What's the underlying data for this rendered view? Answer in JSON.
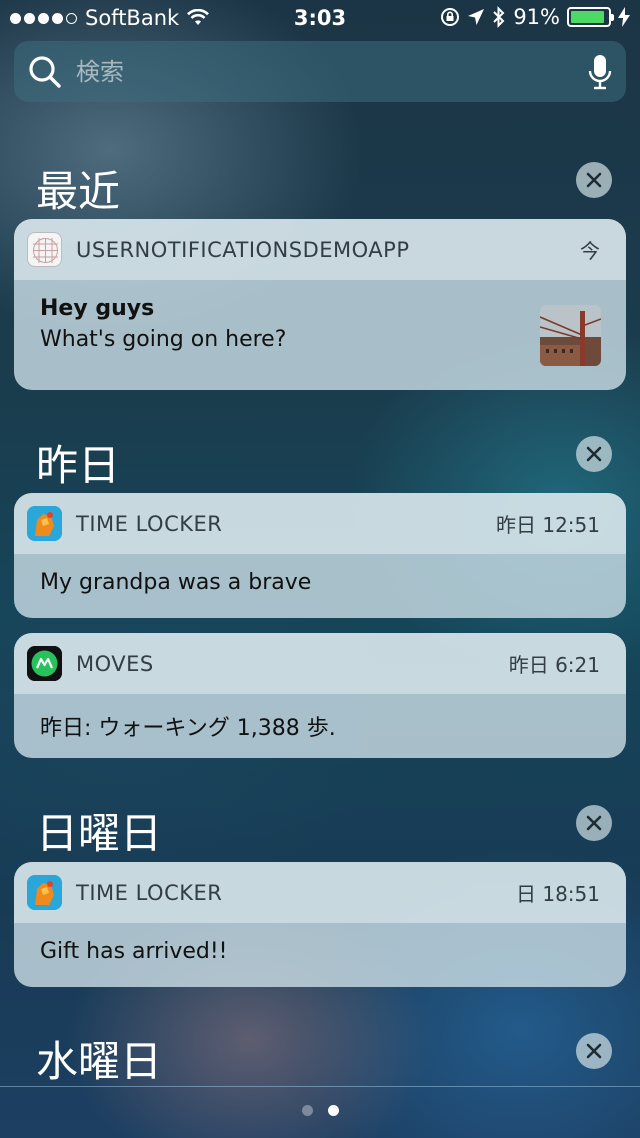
{
  "status_bar": {
    "carrier": "SoftBank",
    "time": "3:03",
    "battery_percent": "91%",
    "battery_level": 0.91,
    "signal_dots_filled": 4,
    "signal_dots_total": 5
  },
  "search": {
    "placeholder": "検索"
  },
  "sections": [
    {
      "title": "最近",
      "notifications": [
        {
          "app": "USERNOTIFICATIONSDEMOAPP",
          "time": "今",
          "title": "Hey guys",
          "body": "What's going on here?",
          "icon": "grid-app-icon",
          "has_thumbnail": true
        }
      ]
    },
    {
      "title": "昨日",
      "notifications": [
        {
          "app": "TIME LOCKER",
          "time": "昨日 12:51",
          "body": "My grandpa was a brave",
          "icon": "time-locker-icon"
        },
        {
          "app": "MOVES",
          "time": "昨日 6:21",
          "body": "昨日: ウォーキング 1,388 歩.",
          "icon": "moves-icon"
        }
      ]
    },
    {
      "title": "日曜日",
      "notifications": [
        {
          "app": "TIME LOCKER",
          "time": "日 18:51",
          "body": "Gift has arrived!!",
          "icon": "time-locker-icon"
        }
      ]
    },
    {
      "title": "水曜日",
      "notifications": []
    }
  ],
  "pager": {
    "pages": 2,
    "active": 2
  },
  "colors": {
    "battery": "#4cd964",
    "moves_green": "#27c25b"
  }
}
